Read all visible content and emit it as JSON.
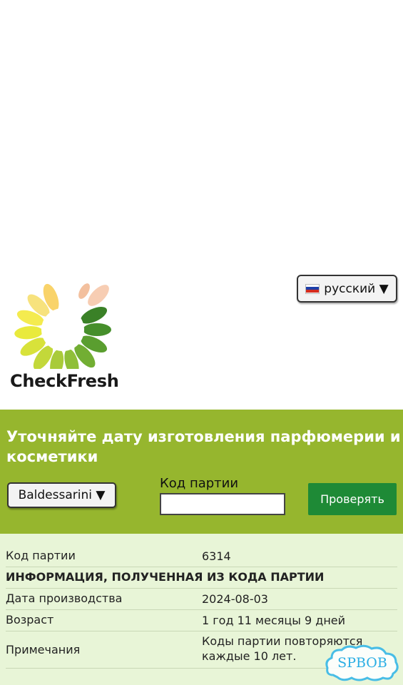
{
  "language_selector": {
    "flag": "russia-flag-icon",
    "label": "русский ▼"
  },
  "logo": {
    "text": "CheckFresh"
  },
  "headline": "Уточняйте дату изготовления парфюмерии и косметики",
  "form": {
    "brand_select": "Baldessarini ▼",
    "code_label": "Код партии",
    "code_value": "",
    "check_button": "Проверять"
  },
  "results": {
    "rows": [
      {
        "key": "Код партии",
        "value": "6314"
      },
      {
        "key": "ИНФОРМАЦИЯ, ПОЛУЧЕННАЯ ИЗ КОДА ПАРТИИ",
        "value": ""
      },
      {
        "key": "Дата производства",
        "value": "2024-08-03"
      },
      {
        "key": "Возраст",
        "value": "1 год 11 месяцы 9 дней"
      },
      {
        "key": "Примечания",
        "value": "Коды партии повторяются каждые 10 лет."
      }
    ]
  },
  "watermark": {
    "text": "SPBOB"
  },
  "colors": {
    "band": "#96b62e",
    "button": "#1e8a36",
    "results_bg": "#e8f5d7"
  }
}
